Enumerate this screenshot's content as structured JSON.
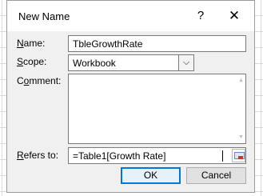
{
  "dialog": {
    "title": "New Name",
    "help_glyph": "?",
    "close_glyph": "✕"
  },
  "fields": {
    "name_label_key": "N",
    "name_label_rest": "ame:",
    "name_value": "TbleGrowthRate",
    "scope_label_key": "S",
    "scope_label_rest": "cope:",
    "scope_value": "Workbook",
    "comment_label_pre": "C",
    "comment_label_key": "o",
    "comment_label_rest": "mment:",
    "comment_value": "",
    "refers_label_key": "R",
    "refers_label_rest": "efers to:",
    "refers_value": "=Table1[Growth Rate]"
  },
  "buttons": {
    "ok": "OK",
    "cancel": "Cancel"
  },
  "icons": {
    "help": "help-icon",
    "close": "close-icon",
    "dropdown": "chevron-down-icon",
    "scroll_up": "scroll-up-icon",
    "scroll_down": "scroll-down-icon",
    "range_picker": "range-select-icon"
  }
}
